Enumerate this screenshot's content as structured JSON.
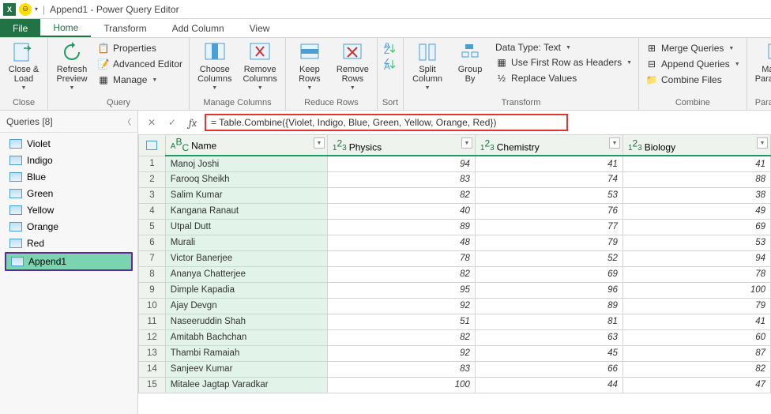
{
  "title": "Append1 - Power Query Editor",
  "tabs": {
    "file": "File",
    "home": "Home",
    "transform": "Transform",
    "addcol": "Add Column",
    "view": "View"
  },
  "ribbon": {
    "closeload": "Close &\nLoad",
    "closeload_grp": "Close",
    "refresh": "Refresh\nPreview",
    "props": "Properties",
    "adved": "Advanced Editor",
    "manage": "Manage",
    "query_grp": "Query",
    "choosecols": "Choose\nColumns",
    "removecols": "Remove\nColumns",
    "mgcol_grp": "Manage Columns",
    "keeprows": "Keep\nRows",
    "removerows": "Remove\nRows",
    "rr_grp": "Reduce Rows",
    "sort_grp": "Sort",
    "splitcol": "Split\nColumn",
    "groupby": "Group\nBy",
    "datatype": "Data Type: Text",
    "firstrow": "Use First Row as Headers",
    "replace": "Replace Values",
    "transform_grp": "Transform",
    "merge": "Merge Queries",
    "append": "Append Queries",
    "combinefiles": "Combine Files",
    "combine_grp": "Combine",
    "mgparams": "Manage\nParameters",
    "params_grp": "Parameters"
  },
  "queries_hdr": "Queries [8]",
  "queries": [
    "Violet",
    "Indigo",
    "Blue",
    "Green",
    "Yellow",
    "Orange",
    "Red",
    "Append1"
  ],
  "formula": "= Table.Combine({Violet, Indigo, Blue, Green, Yellow, Orange, Red})",
  "cols": {
    "name": "Name",
    "phys": "Physics",
    "chem": "Chemistry",
    "bio": "Biology"
  },
  "rows": [
    {
      "n": "1",
      "name": "Manoj Joshi",
      "p": "94",
      "c": "41",
      "b": "41"
    },
    {
      "n": "2",
      "name": "Farooq Sheikh",
      "p": "83",
      "c": "74",
      "b": "88"
    },
    {
      "n": "3",
      "name": "Salim Kumar",
      "p": "82",
      "c": "53",
      "b": "38"
    },
    {
      "n": "4",
      "name": "Kangana Ranaut",
      "p": "40",
      "c": "76",
      "b": "49"
    },
    {
      "n": "5",
      "name": "Utpal Dutt",
      "p": "89",
      "c": "77",
      "b": "69"
    },
    {
      "n": "6",
      "name": "Murali",
      "p": "48",
      "c": "79",
      "b": "53"
    },
    {
      "n": "7",
      "name": "Victor Banerjee",
      "p": "78",
      "c": "52",
      "b": "94"
    },
    {
      "n": "8",
      "name": "Ananya Chatterjee",
      "p": "82",
      "c": "69",
      "b": "78"
    },
    {
      "n": "9",
      "name": "Dimple Kapadia",
      "p": "95",
      "c": "96",
      "b": "100"
    },
    {
      "n": "10",
      "name": "Ajay Devgn",
      "p": "92",
      "c": "89",
      "b": "79"
    },
    {
      "n": "11",
      "name": "Naseeruddin Shah",
      "p": "51",
      "c": "81",
      "b": "41"
    },
    {
      "n": "12",
      "name": "Amitabh Bachchan",
      "p": "82",
      "c": "63",
      "b": "60"
    },
    {
      "n": "13",
      "name": "Thambi Ramaiah",
      "p": "92",
      "c": "45",
      "b": "87"
    },
    {
      "n": "14",
      "name": "Sanjeev Kumar",
      "p": "83",
      "c": "66",
      "b": "82"
    },
    {
      "n": "15",
      "name": "Mitalee Jagtap Varadkar",
      "p": "100",
      "c": "44",
      "b": "47"
    }
  ]
}
